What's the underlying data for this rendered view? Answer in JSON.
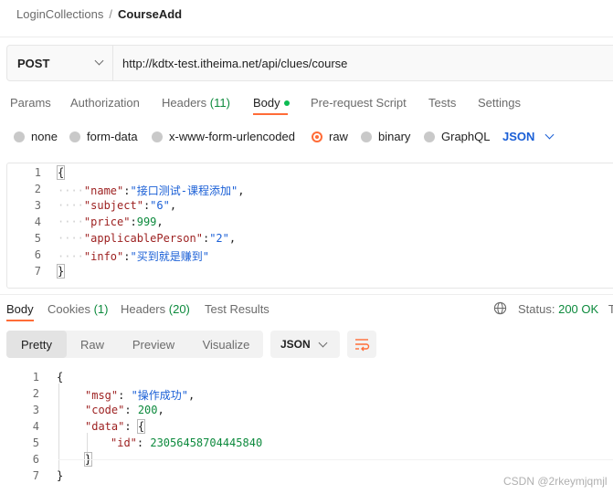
{
  "breadcrumb": {
    "parent": "LoginCollections",
    "separator": "/",
    "current": "CourseAdd"
  },
  "request": {
    "method": "POST",
    "url": "http://kdtx-test.itheima.net/api/clues/course"
  },
  "request_tabs": {
    "params": "Params",
    "authorization": "Authorization",
    "headers": "Headers",
    "headers_count": "(11)",
    "body": "Body",
    "prerequest": "Pre-request Script",
    "tests": "Tests",
    "settings": "Settings"
  },
  "body_types": {
    "none": "none",
    "form_data": "form-data",
    "urlencoded": "x-www-form-urlencoded",
    "raw": "raw",
    "binary": "binary",
    "graphql": "GraphQL",
    "selected": "raw",
    "format": "JSON"
  },
  "request_body": {
    "line_numbers": [
      "1",
      "2",
      "3",
      "4",
      "5",
      "6",
      "7"
    ],
    "open_brace": "{",
    "close_brace": "}",
    "fields": [
      {
        "key": "\"name\"",
        "value": "\"接口测试-课程添加\"",
        "tail": ","
      },
      {
        "key": "\"subject\"",
        "value": "\"6\"",
        "tail": ","
      },
      {
        "key": "\"price\"",
        "value": "999",
        "tail": ","
      },
      {
        "key": "\"applicablePerson\"",
        "value": "\"2\"",
        "tail": ","
      },
      {
        "key": "\"info\"",
        "value": "\"买到就是赚到\"",
        "tail": ""
      }
    ],
    "indent": "····"
  },
  "response_tabs": {
    "body": "Body",
    "cookies": "Cookies",
    "cookies_count": "(1)",
    "headers": "Headers",
    "headers_count": "(20)",
    "test_results": "Test Results",
    "status_label": "Status:",
    "status_value": "200 OK",
    "time_label": "Ti"
  },
  "response_view": {
    "pretty": "Pretty",
    "raw": "Raw",
    "preview": "Preview",
    "visualize": "Visualize",
    "format": "JSON"
  },
  "response_body": {
    "line_numbers": [
      "1",
      "2",
      "3",
      "4",
      "5",
      "6",
      "7"
    ],
    "open_brace": "{",
    "close_brace": "}",
    "msg_key": "\"msg\"",
    "msg_value": "\"操作成功\"",
    "code_key": "\"code\"",
    "code_value": "200",
    "data_key": "\"data\"",
    "data_open": "{",
    "id_key": "\"id\"",
    "id_value": "23056458704445840",
    "data_close": "}"
  },
  "watermark": "CSDN @2rkeymjqmjl",
  "colors": {
    "accent": "#ff6c37",
    "count_green": "#0d8a3d",
    "link_blue": "#1a5fd6",
    "json_key": "#9c1f1f"
  }
}
